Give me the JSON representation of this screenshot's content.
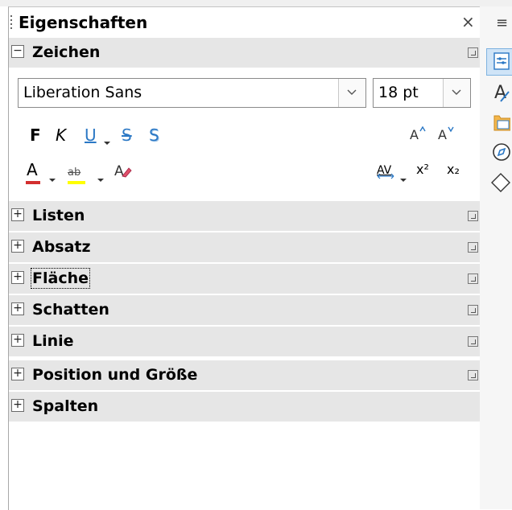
{
  "panel": {
    "title": "Eigenschaften",
    "close_icon": "×"
  },
  "sections": {
    "zeichen": {
      "label": "Zeichen",
      "expanded": true,
      "expander": "−",
      "font_name": "Liberation Sans",
      "font_size": "18 pt",
      "bold_label": "F",
      "italic_label": "K",
      "underline_label": "U",
      "strikethrough_label": "S",
      "shadow_label": "S",
      "font_color_label": "A",
      "highlight_label": "ab",
      "spacing_label": "AV",
      "superscript_label": "x²",
      "subscript_label": "x₂",
      "font_color": "#d32f2f",
      "highlight_color": "#ffff00"
    },
    "collapsed": [
      {
        "label": "Listen",
        "expander": "+",
        "has_more": true
      },
      {
        "label": "Absatz",
        "expander": "+",
        "has_more": true
      },
      {
        "label": "Fläche",
        "expander": "+",
        "has_more": true,
        "focused": true
      },
      {
        "label": "Schatten",
        "expander": "+",
        "has_more": true
      },
      {
        "label": "Linie",
        "expander": "+",
        "has_more": true
      },
      {
        "label": "Position und Größe",
        "expander": "+",
        "has_more": true
      },
      {
        "label": "Spalten",
        "expander": "+",
        "has_more": false
      }
    ]
  },
  "sidebar": {
    "menu_icon": "≡",
    "tabs": [
      "properties-icon",
      "styles-icon",
      "gallery-icon",
      "navigator-icon",
      "shapes-icon"
    ],
    "active_tab": "properties-icon"
  },
  "colors": {
    "section_bg": "#e6e6e6",
    "active_tab_bg": "#cfe4f7",
    "accent_blue": "#2b78c5"
  }
}
